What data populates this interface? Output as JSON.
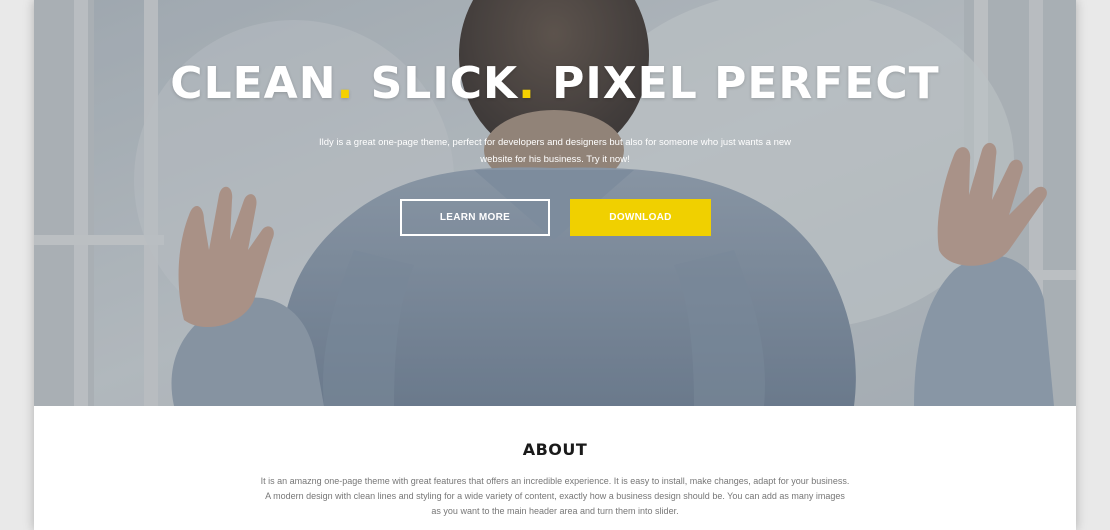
{
  "hero": {
    "title_parts": [
      "CLEAN",
      ".",
      " SLICK",
      ".",
      " PIXEL PERFECT"
    ],
    "description": "Ildy is a great one-page theme, perfect for developers and designers but also for someone who just wants a new website for his business. Try it now!",
    "learn_more_label": "LEARN MORE",
    "download_label": "DOWNLOAD"
  },
  "about": {
    "title": "ABOUT",
    "text": "It is an amazng one-page theme with great features that offers an incredible experience. It is easy to install, make changes, adapt for your business. A modern design with clean lines and styling for a wide variety of content, exactly how a business design should be. You can add as many images as you want to the main header area and turn them into slider."
  },
  "colors": {
    "accent": "#f0d000",
    "hero_overlay": "#3c4a58",
    "about_text": "#777777",
    "heading_dark": "#1a1a1a"
  }
}
